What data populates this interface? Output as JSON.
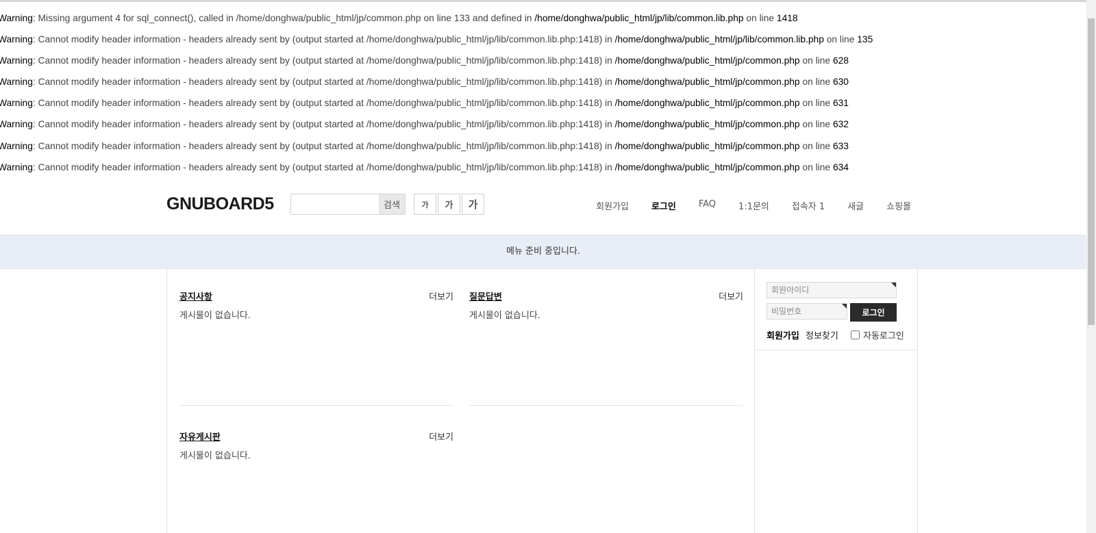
{
  "warnings": [
    {
      "label": "Warning",
      "text": ": Missing argument 4 for sql_connect(), called in /home/donghwa/public_html/jp/common.php on line 133 and defined in ",
      "path": "/home/donghwa/public_html/jp/lib/common.lib.php",
      "online": " on line ",
      "line": "1418"
    },
    {
      "label": "Warning",
      "text": ": Cannot modify header information - headers already sent by (output started at /home/donghwa/public_html/jp/lib/common.lib.php:1418) in ",
      "path": "/home/donghwa/public_html/jp/lib/common.lib.php",
      "online": " on line ",
      "line": "135"
    },
    {
      "label": "Warning",
      "text": ": Cannot modify header information - headers already sent by (output started at /home/donghwa/public_html/jp/lib/common.lib.php:1418) in ",
      "path": "/home/donghwa/public_html/jp/common.php",
      "online": " on line ",
      "line": "628"
    },
    {
      "label": "Warning",
      "text": ": Cannot modify header information - headers already sent by (output started at /home/donghwa/public_html/jp/lib/common.lib.php:1418) in ",
      "path": "/home/donghwa/public_html/jp/common.php",
      "online": " on line ",
      "line": "630"
    },
    {
      "label": "Warning",
      "text": ": Cannot modify header information - headers already sent by (output started at /home/donghwa/public_html/jp/lib/common.lib.php:1418) in ",
      "path": "/home/donghwa/public_html/jp/common.php",
      "online": " on line ",
      "line": "631"
    },
    {
      "label": "Warning",
      "text": ": Cannot modify header information - headers already sent by (output started at /home/donghwa/public_html/jp/lib/common.lib.php:1418) in ",
      "path": "/home/donghwa/public_html/jp/common.php",
      "online": " on line ",
      "line": "632"
    },
    {
      "label": "Warning",
      "text": ": Cannot modify header information - headers already sent by (output started at /home/donghwa/public_html/jp/lib/common.lib.php:1418) in ",
      "path": "/home/donghwa/public_html/jp/common.php",
      "online": " on line ",
      "line": "633"
    },
    {
      "label": "Warning",
      "text": ": Cannot modify header information - headers already sent by (output started at /home/donghwa/public_html/jp/lib/common.lib.php:1418) in ",
      "path": "/home/donghwa/public_html/jp/common.php",
      "online": " on line ",
      "line": "634"
    }
  ],
  "header": {
    "logo": "GNUBOARD5",
    "search_value": "",
    "search_button": "검색",
    "font_sizes": [
      "가",
      "가",
      "가"
    ],
    "nav": [
      {
        "label": "회원가입",
        "strong": false
      },
      {
        "label": "로그인",
        "strong": true
      },
      {
        "label": "FAQ",
        "strong": false
      },
      {
        "label": "1:1문의",
        "strong": false
      },
      {
        "label": "접속자 1",
        "strong": false
      },
      {
        "label": "새글",
        "strong": false
      },
      {
        "label": "쇼핑몰",
        "strong": false
      }
    ]
  },
  "menu_notice": "메뉴 준비 중입니다.",
  "boards": [
    {
      "title": "공지사항",
      "more": "더보기",
      "empty": "게시물이 없습니다."
    },
    {
      "title": "질문답변",
      "more": "더보기",
      "empty": "게시물이 없습니다."
    },
    {
      "title": "자유게시판",
      "more": "더보기",
      "empty": "게시물이 없습니다."
    }
  ],
  "login_box": {
    "id_placeholder": "회원아이디",
    "pw_placeholder": "비밀번호",
    "login_button": "로그인",
    "join_link": "회원가입",
    "find_link": "정보찾기",
    "auto_login": "자동로그인"
  }
}
